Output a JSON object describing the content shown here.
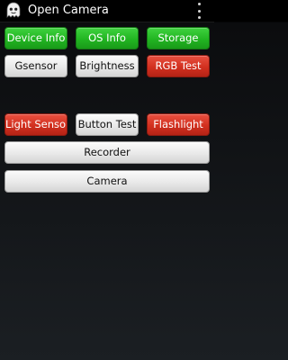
{
  "app": {
    "title": "Open Camera",
    "icon": "ghost-app-icon"
  },
  "menu": {
    "overflow_icon": "more-vert-icon"
  },
  "buttons": {
    "device_info": "Device Info",
    "os_info": "OS Info",
    "storage": "Storage",
    "gsensor": "Gsensor",
    "brightness": "Brightness",
    "rgb_test": "RGB Test",
    "light_sensor": "Light Sensor",
    "button_test": "Button Test",
    "flashlight": "Flashlight",
    "recorder": "Recorder",
    "camera": "Camera"
  },
  "colors": {
    "pass_green": "#22b522",
    "fail_red": "#d2301f",
    "neutral_gray": "#e9e9e9",
    "background": "#15181b"
  }
}
